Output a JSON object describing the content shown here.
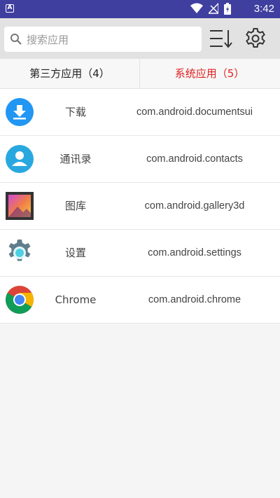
{
  "status_bar": {
    "time": "3:42",
    "badge": "A"
  },
  "search": {
    "placeholder": "搜索应用",
    "value": ""
  },
  "icons": {
    "sort": "sort-lines-icon",
    "settings": "gear-icon",
    "search": "search-icon"
  },
  "tabs": [
    {
      "label": "第三方应用（4）",
      "active": false
    },
    {
      "label": "系统应用（5）",
      "active": true
    }
  ],
  "colors": {
    "status_bar": "#3f3fa0",
    "active_tab": "#e02020",
    "toolbar": "#e2e2e2"
  },
  "apps": [
    {
      "name": "下载",
      "package": "com.android.documentsui",
      "icon": "download-icon"
    },
    {
      "name": "通讯录",
      "package": "com.android.contacts",
      "icon": "contacts-icon"
    },
    {
      "name": "图库",
      "package": "com.android.gallery3d",
      "icon": "gallery-icon"
    },
    {
      "name": "设置",
      "package": "com.android.settings",
      "icon": "settings-app-icon"
    },
    {
      "name": "Chrome",
      "package": "com.android.chrome",
      "icon": "chrome-icon"
    }
  ]
}
